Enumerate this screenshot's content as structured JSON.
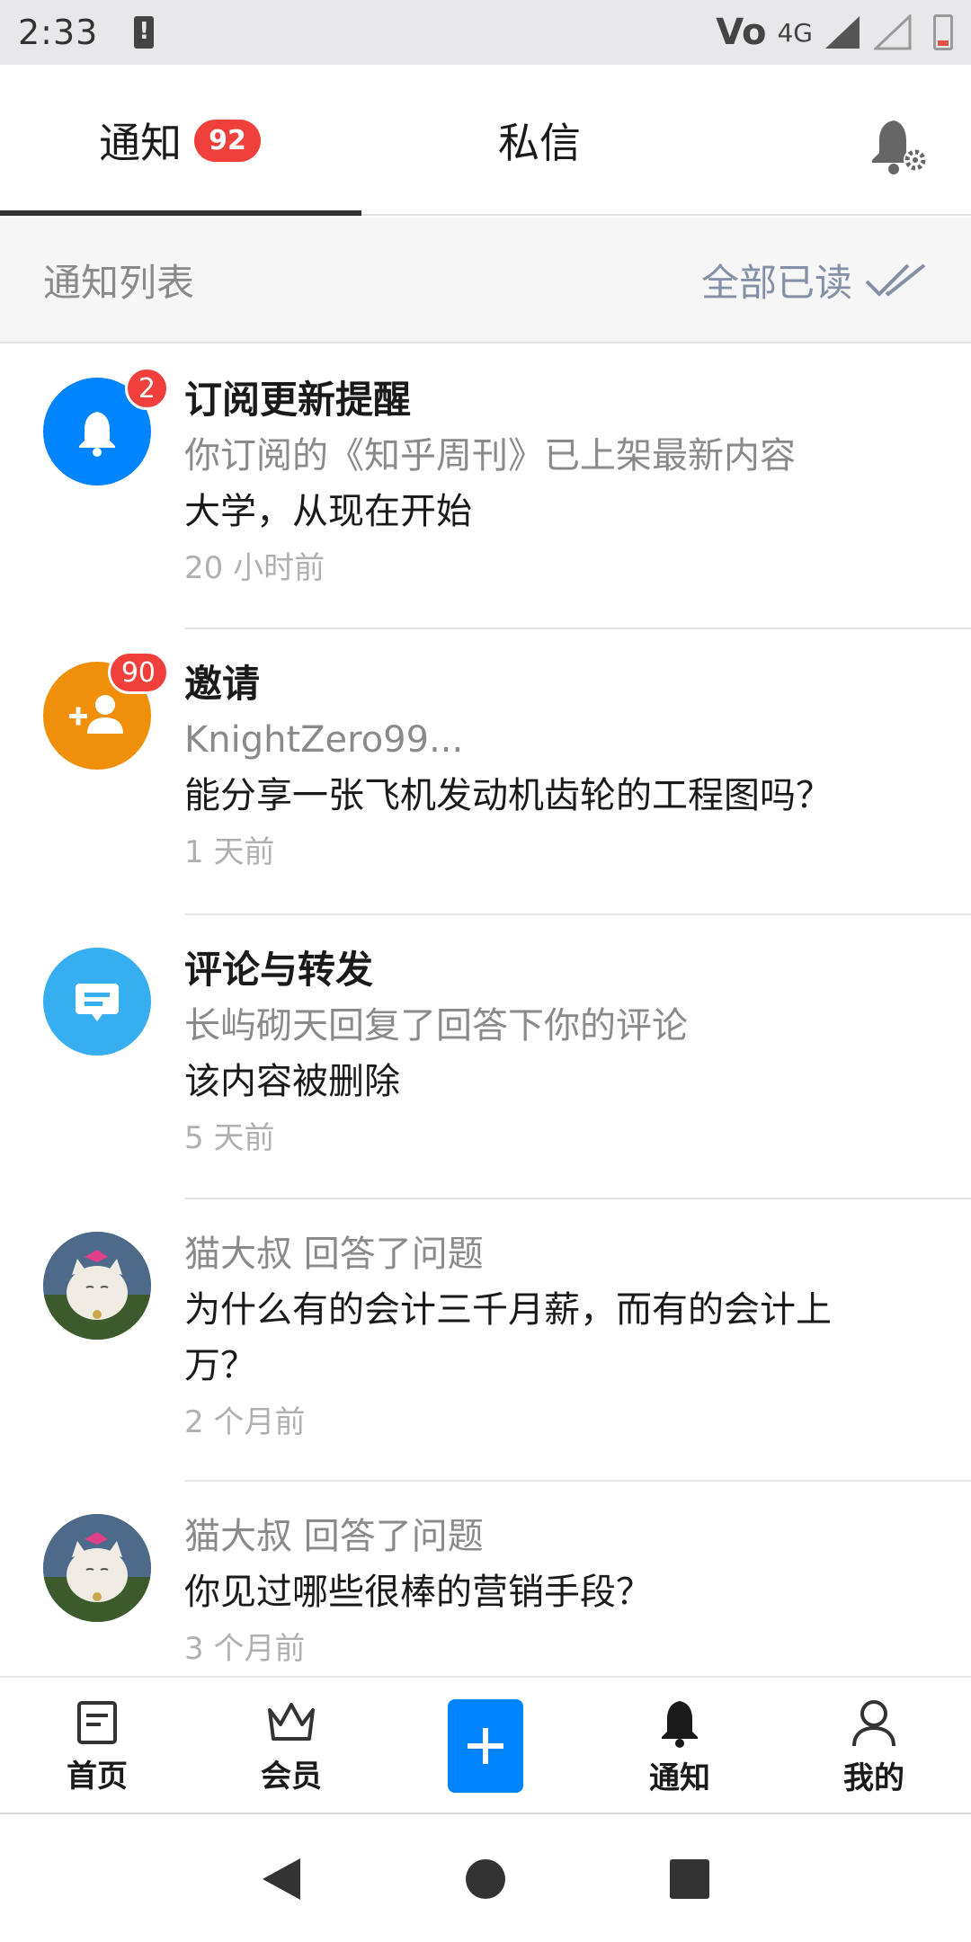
{
  "status_bar": {
    "time": "2:33",
    "network": "4G"
  },
  "tabs": {
    "notice_label": "通知",
    "notice_badge": "92",
    "dm_label": "私信"
  },
  "list_header": {
    "title": "通知列表",
    "mark_all_read": "全部已读"
  },
  "notifications": [
    {
      "title": "订阅更新提醒",
      "subtitle": "你订阅的《知乎周刊》已上架最新内容",
      "body": "大学，从现在开始",
      "time": "20 小时前",
      "badge": "2",
      "icon": "bell-icon",
      "color": "#0084ff"
    },
    {
      "title": "邀请",
      "subtitle": "KnightZero99...",
      "body": "能分享一张飞机发动机齿轮的工程图吗？",
      "time": "1 天前",
      "badge": "90",
      "icon": "add-user-icon",
      "color": "#f0900a"
    },
    {
      "title": "评论与转发",
      "subtitle": "长屿砌天回复了回答下你的评论",
      "body": "该内容被删除",
      "time": "5 天前",
      "icon": "comment-icon",
      "color": "#36aef0"
    },
    {
      "subtitle": "猫大叔 回答了问题",
      "body": "为什么有的会计三千月薪，而有的会计上万？",
      "time": "2 个月前",
      "icon": "cat-avatar"
    },
    {
      "subtitle": "猫大叔 回答了问题",
      "body": "你见过哪些很棒的营销手段？",
      "time": "3 个月前",
      "icon": "cat-avatar"
    }
  ],
  "bottom_nav": {
    "home": "首页",
    "member": "会员",
    "notice": "通知",
    "mine": "我的"
  }
}
